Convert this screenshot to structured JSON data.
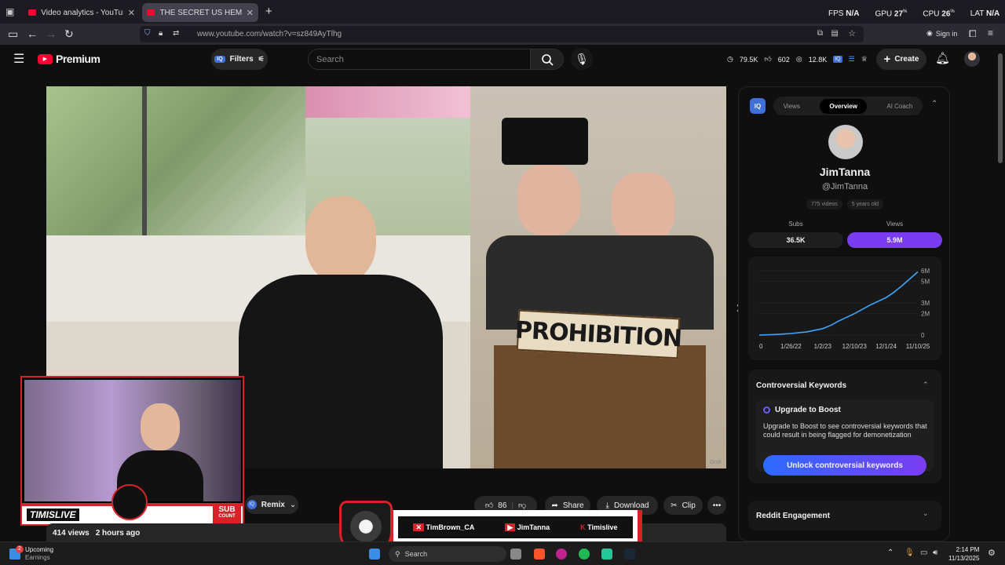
{
  "browser": {
    "tabs": [
      {
        "title": "Video analytics - YouTube Studio"
      },
      {
        "title": "THE SECRET US HEMP BAN! - YouTube"
      }
    ],
    "url": "www.youtube.com/watch?v=sz849AyTlhg",
    "sign_in": "Sign in"
  },
  "overlay_stats": {
    "fps_label": "FPS",
    "fps_value": "N/A",
    "gpu_label": "GPU",
    "gpu_value": "27",
    "cpu_label": "CPU",
    "cpu_value": "26",
    "lat_label": "LAT",
    "lat_value": "N/A"
  },
  "youtube": {
    "logo_text": "Premium",
    "filters_label": "Filters",
    "search_placeholder": "Search",
    "stats": {
      "views": "79.5K",
      "likes": "602",
      "watch": "12.8K"
    },
    "create_label": "Create"
  },
  "video": {
    "thumbnail_text": "PROHIBITION",
    "credit": "Grok"
  },
  "webcam": {
    "brand": "TIMISLIVE",
    "sub_label": "SUB",
    "count_label": "COUNT"
  },
  "below_video": {
    "remix_label": "Remix",
    "like_count": "86",
    "share_label": "Share",
    "download_label": "Download",
    "clip_label": "Clip",
    "views": "414 views",
    "posted": "2 hours ago"
  },
  "sub_banner": {
    "handles": [
      "TimBrown_CA",
      "JimTanna",
      "Timislive"
    ]
  },
  "sidebar": {
    "tabs": [
      "Views",
      "Overview",
      "AI Coach"
    ],
    "channel_name": "JimTanna",
    "handle": "@JimTanna",
    "chip_videos": "775 videos",
    "chip_age": "5 years old",
    "subs_label": "Subs",
    "subs_value": "36.5K",
    "views_label": "Views",
    "views_value": "5.9M",
    "controversial_title": "Controversial Keywords",
    "upgrade_title": "Upgrade to Boost",
    "upgrade_desc": "Upgrade to Boost to see controversial keywords that could result in being flagged for demonetization",
    "unlock_label": "Unlock controversial keywords",
    "reddit_title": "Reddit Engagement"
  },
  "chart_data": {
    "type": "line",
    "x_ticks": [
      "0",
      "1/26/22",
      "1/2/23",
      "12/10/23",
      "12/1/24",
      "11/10/25"
    ],
    "y_ticks": [
      "0",
      "2M",
      "3M",
      "5M",
      "6M"
    ],
    "ylim": [
      0,
      6000000
    ],
    "series": [
      {
        "x": [
          0,
          0.1,
          0.2,
          0.3,
          0.4,
          0.45,
          0.5,
          0.6,
          0.7,
          0.8,
          0.85,
          0.9,
          1.0
        ],
        "values": [
          0,
          50000,
          150000,
          300000,
          600000,
          900000,
          1300000,
          2000000,
          2800000,
          3500000,
          4000000,
          4600000,
          5900000
        ]
      }
    ],
    "color": "#3ea6ff"
  },
  "taskbar": {
    "upcoming": "Upcoming",
    "earnings": "Earnings",
    "badge": "2",
    "search": "Search",
    "time": "2:14 PM",
    "date": "11/13/2025"
  }
}
